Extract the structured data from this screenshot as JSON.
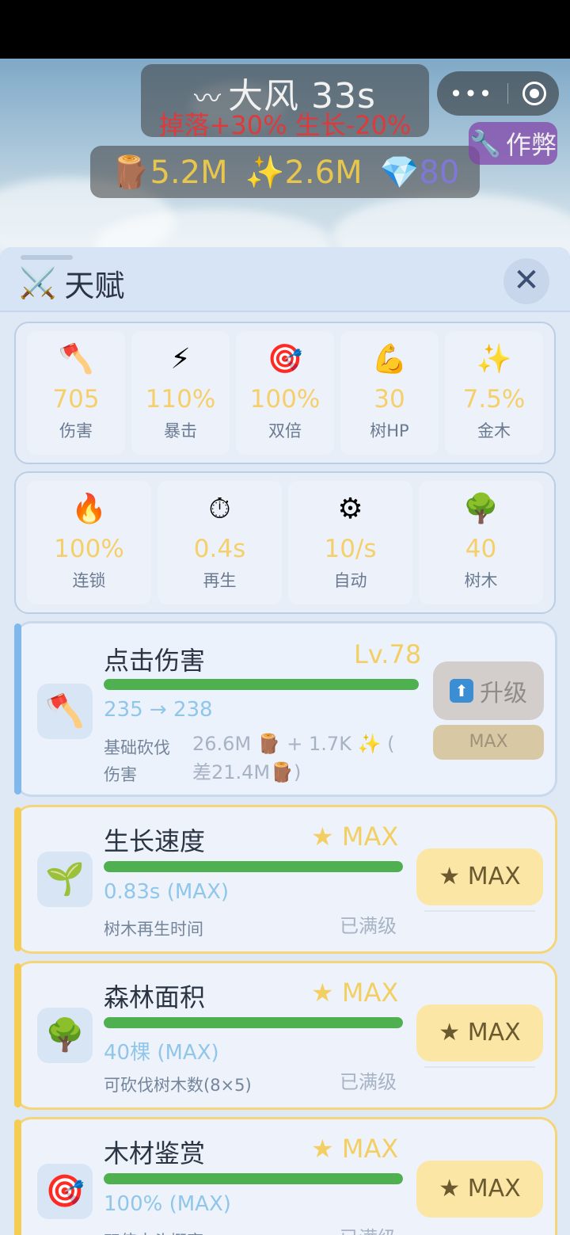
{
  "weather": {
    "title": "大风 33s",
    "icon": "wind-icon",
    "effect": "掉落+30% 生长-20%"
  },
  "resources": {
    "wood": "5.2M",
    "gold": "2.6M",
    "gems": "80"
  },
  "capsule": {
    "more": "•••"
  },
  "cheat_label": "作弊",
  "panel": {
    "title": "天赋",
    "close": "✕"
  },
  "stats_row1": [
    {
      "icon": "axe-icon",
      "glyph": "🪓",
      "value": "705",
      "label": "伤害"
    },
    {
      "icon": "lightning-icon",
      "glyph": "⚡",
      "value": "110%",
      "label": "暴击"
    },
    {
      "icon": "target-icon",
      "glyph": "🎯",
      "value": "100%",
      "label": "双倍"
    },
    {
      "icon": "muscle-icon",
      "glyph": "💪",
      "value": "30",
      "label": "树HP"
    },
    {
      "icon": "sparkles-icon",
      "glyph": "✨",
      "value": "7.5%",
      "label": "金木"
    }
  ],
  "stats_row2": [
    {
      "icon": "fire-icon",
      "glyph": "🔥",
      "value": "100%",
      "label": "连锁"
    },
    {
      "icon": "stopwatch-icon",
      "glyph": "⏱",
      "value": "0.4s",
      "label": "再生"
    },
    {
      "icon": "gear-icon",
      "glyph": "⚙",
      "value": "10/s",
      "label": "自动"
    },
    {
      "icon": "tree-icon",
      "glyph": "🌳",
      "value": "40",
      "label": "树木"
    }
  ],
  "talents": [
    {
      "name": "点击伤害",
      "level": "Lv.78",
      "progress": 1.0,
      "value": "235 → 238",
      "desc_line1": "基础砍伐",
      "desc_line2": "伤害",
      "cost_line1": "26.6M 🪵 + 1.7K ✨ (",
      "cost_line2": "差21.4M🪵)",
      "upgrade_label": "升级",
      "max_label": "MAX",
      "icon": "axe-icon",
      "glyph": "🪓"
    },
    {
      "name": "生长速度",
      "level": "★ MAX",
      "progress": 1.0,
      "value": "0.83s (MAX)",
      "desc": "树木再生时间",
      "status": "已满级",
      "button": "★ MAX",
      "icon": "sprout-icon",
      "glyph": "🌱"
    },
    {
      "name": "森林面积",
      "level": "★ MAX",
      "progress": 1.0,
      "value": "40棵 (MAX)",
      "desc": "可砍伐树木数(8×5)",
      "status": "已满级",
      "button": "★ MAX",
      "icon": "tree-icon",
      "glyph": "🌳"
    },
    {
      "name": "木材鉴赏",
      "level": "★ MAX",
      "progress": 1.0,
      "value": "100% (MAX)",
      "desc": "双倍木头概率",
      "status": "已满级",
      "button": "★ MAX",
      "icon": "target-icon",
      "glyph": "🎯"
    }
  ],
  "colors": {
    "accent_blue": "#7fb8ec",
    "accent_gold": "#f5cd52",
    "progress_green": "#4fb050"
  }
}
